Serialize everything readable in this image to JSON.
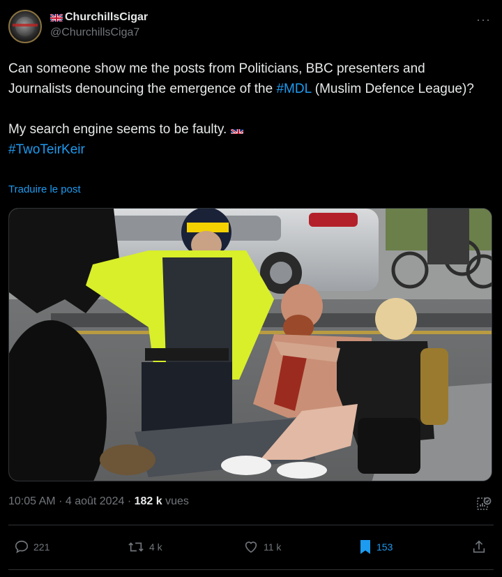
{
  "user": {
    "display_name": "ChurchillsCigar",
    "handle": "@ChurchillsCiga7",
    "flag_icon": "uk-flag-icon"
  },
  "tweet": {
    "paragraph1_pre": "Can someone show me the posts from Politicians, BBC presenters and Journalists denouncing the emergence of the ",
    "paragraph1_hashtag": "#MDL",
    "paragraph1_post": " (Muslim Defence League)?",
    "paragraph2": "My search engine seems to be faulty.",
    "hashtag2": "#TwoTeirKeir",
    "translate_label": "Traduire le post"
  },
  "meta": {
    "time": "10:05 AM",
    "date": "4 août 2024",
    "views_count": "182 k",
    "views_label": "vues"
  },
  "actions": {
    "replies": "221",
    "reposts": "4 k",
    "likes": "11 k",
    "bookmarks": "153"
  },
  "colors": {
    "accent": "#1d9bf0",
    "muted": "#71767b",
    "text": "#e7e9ea",
    "background": "#000000",
    "border": "#2f3336"
  }
}
